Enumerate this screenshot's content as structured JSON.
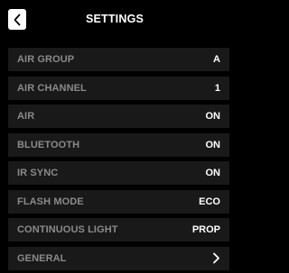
{
  "header": {
    "title": "SETTINGS",
    "back_icon": "chevron-left-icon"
  },
  "settings": [
    {
      "label": "AIR GROUP",
      "value": "A"
    },
    {
      "label": "AIR CHANNEL",
      "value": "1"
    },
    {
      "label": "AIR",
      "value": "ON"
    },
    {
      "label": "BLUETOOTH",
      "value": "ON"
    },
    {
      "label": "IR SYNC",
      "value": "ON"
    },
    {
      "label": "FLASH MODE",
      "value": "ECO"
    },
    {
      "label": "CONTINUOUS LIGHT",
      "value": "PROP"
    },
    {
      "label": "GENERAL",
      "icon": "chevron-right-icon"
    }
  ],
  "colors": {
    "background": "#000000",
    "row_background": "#191919",
    "label": "#8a8a8a",
    "value": "#ffffff"
  }
}
